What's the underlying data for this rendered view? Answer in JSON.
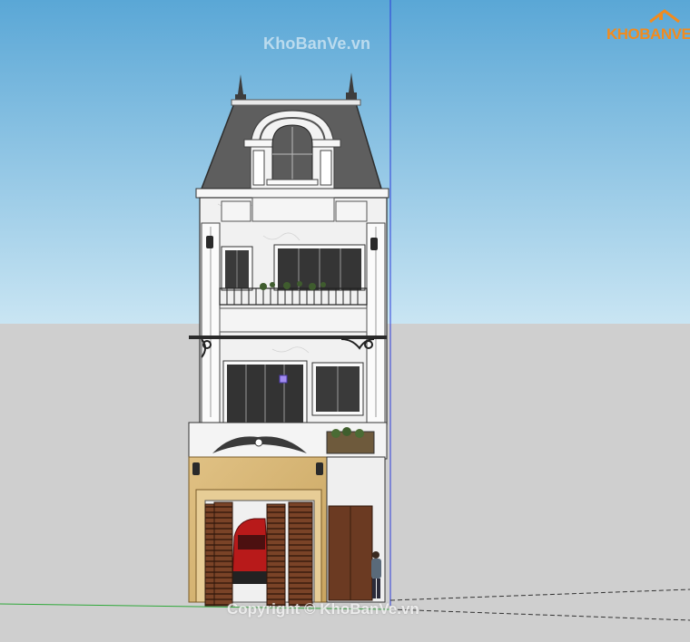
{
  "watermark_top": "KhoBanVe.vn",
  "watermark_bottom": "Copyright © KhoBanVe.vn",
  "logo_text": "KHOBANVE",
  "colors": {
    "sky_top": "#5aa7d6",
    "sky_bottom": "#c9e5f3",
    "ground": "#cfcfcf",
    "facade": "#f1f1f1",
    "roof": "#5e5e5e",
    "wood": "#6b3a22",
    "gate_wall": "#d8b878",
    "logo_orange": "#f28b1e"
  }
}
